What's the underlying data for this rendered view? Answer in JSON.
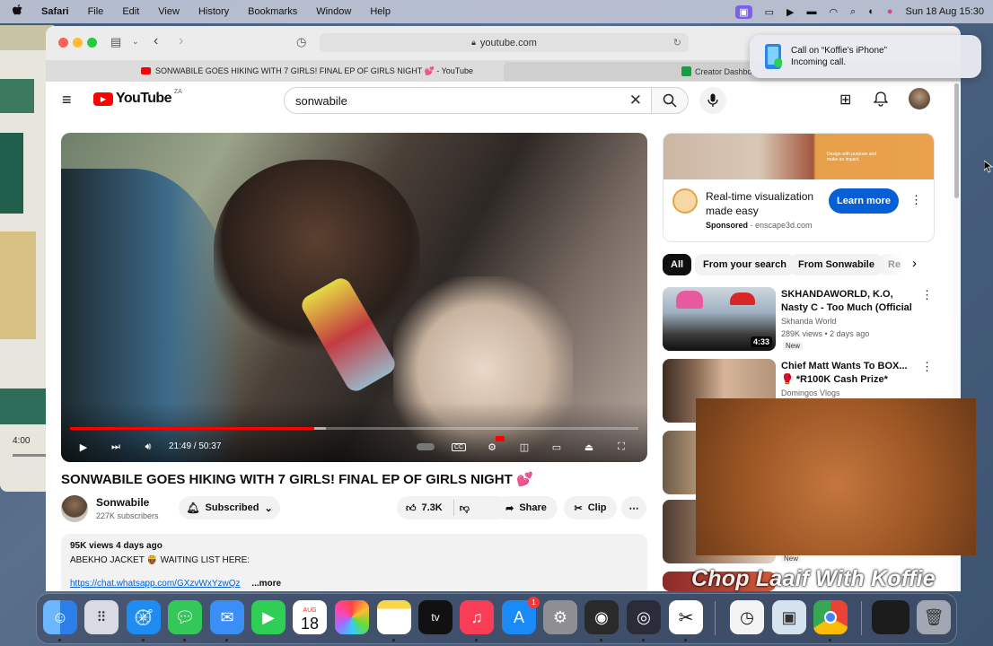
{
  "menubar": {
    "apple": "",
    "items": [
      "Safari",
      "File",
      "Edit",
      "View",
      "History",
      "Bookmarks",
      "Window",
      "Help"
    ],
    "datetime": "Sun 18 Aug  15:30"
  },
  "bg_window": {
    "time": "4:00"
  },
  "browser": {
    "url": "youtube.com",
    "tabs": [
      {
        "label": "SONWABILE GOES HIKING WITH 7 GIRLS! FINAL EP OF GIRLS NIGHT 💕 - YouTube",
        "active": true
      },
      {
        "label": "Creator Dashbo",
        "active": false
      }
    ]
  },
  "youtube": {
    "logo": "YouTube",
    "region": "ZA",
    "search_value": "sonwabile"
  },
  "player": {
    "time": "21:49 / 50:37",
    "progress": 0.43,
    "buffered": 0.45
  },
  "video": {
    "title": "SONWABILE GOES HIKING WITH 7 GIRLS! FINAL EP OF GIRLS NIGHT 💕",
    "channel": "Sonwabile",
    "subscribers": "227K subscribers",
    "subscribed_label": "Subscribed",
    "likes": "7.3K",
    "share_label": "Share",
    "clip_label": "Clip",
    "views_date": "95K views  4 days ago",
    "desc_line": "ABEKHO JACKET 🤴🏾 WAITING LIST HERE:",
    "desc_link": "https://chat.whatsapp.com/GXzvWxYzwQz",
    "more_label": "...more"
  },
  "ad": {
    "title": "Real-time visualization made easy",
    "sponsored": "Sponsored",
    "domain": "enscape3d.com",
    "cta": "Learn more",
    "banner_text": "Design with purpose and make an impact."
  },
  "chips": [
    "All",
    "From your search",
    "From Sonwabile",
    "Re"
  ],
  "recommendations": [
    {
      "title": "SKHANDAWORLD, K.O, Nasty C - Too Much (Official Music...",
      "channel": "Skhanda World",
      "meta": "289K views • 2 days ago",
      "badge": "New",
      "duration": "4:33"
    },
    {
      "title": "Chief Matt Wants To BOX... 🥊 *R100K Cash Prize*",
      "channel": "Domingos Vlogs",
      "meta": "",
      "badge": "",
      "duration": ""
    },
    {
      "title": "",
      "channel": "",
      "meta": "",
      "badge": "",
      "duration": ""
    },
    {
      "title": "",
      "channel": "",
      "meta": "",
      "badge": "New",
      "duration": ""
    }
  ],
  "notification": {
    "title": "Call on “Koffie’s iPhone”",
    "body": "Incoming call."
  },
  "caption": "Chop Laaif With Koffie",
  "dock": {
    "calendar_month": "AUG",
    "calendar_day": "18",
    "appstore_badge": "1"
  },
  "colors": {
    "youtube_red": "#ff0000",
    "cta_blue": "#065fd4",
    "ad_orange": "#e9a24b"
  }
}
